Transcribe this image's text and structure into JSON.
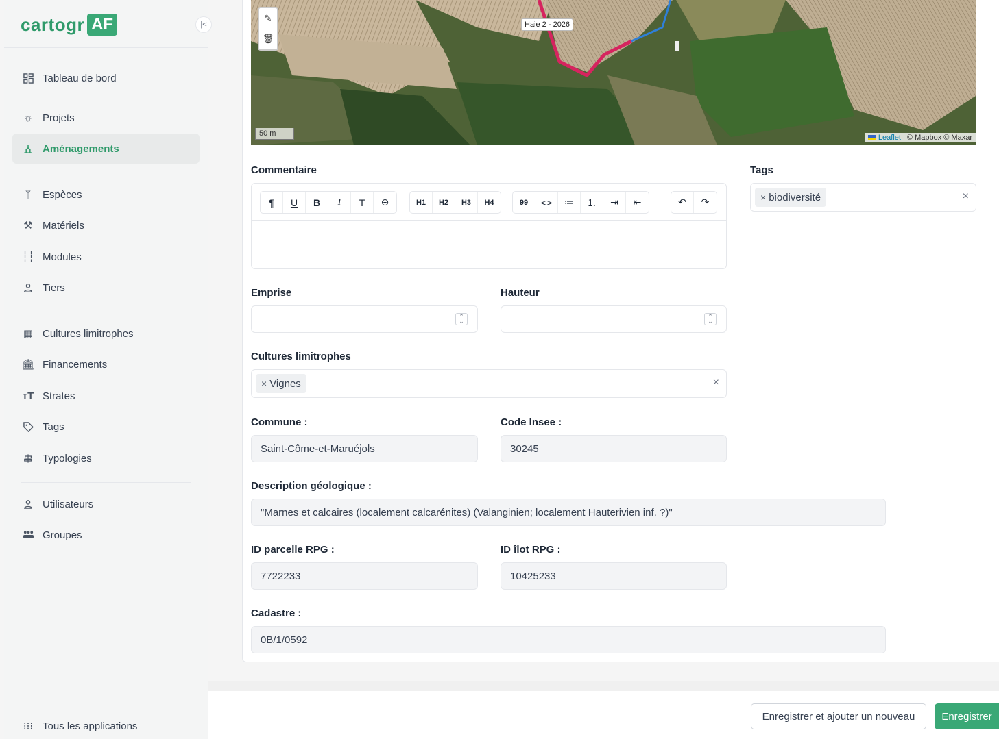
{
  "app": {
    "logo_text": "cartogr",
    "logo_badge": "AF"
  },
  "sidebar": {
    "collapse_icon": "chevrons-left-icon",
    "items": [
      {
        "label": "Tableau de bord",
        "icon": "dashboard-icon"
      },
      {
        "label": "Projets",
        "icon": "sun-icon"
      },
      {
        "label": "Aménagements",
        "icon": "planting-icon",
        "active": true
      },
      {
        "label": "Espèces",
        "icon": "sprout-icon"
      },
      {
        "label": "Matériels",
        "icon": "tools-icon"
      },
      {
        "label": "Modules",
        "icon": "modules-icon"
      },
      {
        "label": "Tiers",
        "icon": "user-icon"
      },
      {
        "label": "Cultures limitrophes",
        "icon": "field-icon"
      },
      {
        "label": "Financements",
        "icon": "bank-icon"
      },
      {
        "label": "Strates",
        "icon": "text-size-icon"
      },
      {
        "label": "Tags",
        "icon": "tag-icon"
      },
      {
        "label": "Typologies",
        "icon": "signpost-icon"
      },
      {
        "label": "Utilisateurs",
        "icon": "user-icon"
      },
      {
        "label": "Groupes",
        "icon": "group-icon"
      }
    ],
    "bottom": {
      "label": "Tous les applications",
      "icon": "grid-dots-icon"
    }
  },
  "map": {
    "feature_label": "Haie 2 - 2026",
    "scale": "50 m",
    "attribution_link": "Leaflet",
    "attribution_rest": " | © Mapbox © Maxar"
  },
  "form": {
    "commentaire": {
      "label": "Commentaire",
      "value": ""
    },
    "tags": {
      "label": "Tags",
      "chips": [
        "biodiversité"
      ]
    },
    "emprise": {
      "label": "Emprise",
      "value": ""
    },
    "hauteur": {
      "label": "Hauteur",
      "value": ""
    },
    "cultures": {
      "label": "Cultures limitrophes",
      "chips": [
        "Vignes"
      ]
    },
    "commune": {
      "label": "Commune :",
      "value": "Saint-Côme-et-Maruéjols"
    },
    "code_insee": {
      "label": "Code Insee :",
      "value": "30245"
    },
    "description_geo": {
      "label": "Description géologique :",
      "value": "\"Marnes et calcaires (localement calcarénites) (Valanginien; localement Hauterivien inf. ?)\""
    },
    "id_parcelle": {
      "label": "ID parcelle RPG :",
      "value": "7722233"
    },
    "id_ilot": {
      "label": "ID îlot RPG :",
      "value": "10425233"
    },
    "cadastre": {
      "label": "Cadastre :",
      "value": "0B/1/0592"
    }
  },
  "toolbar": {
    "group1": [
      "¶",
      "U",
      "B",
      "I",
      "T",
      "⊝"
    ],
    "group2": [
      "H1",
      "H2",
      "H3",
      "H4"
    ],
    "group3": [
      "99",
      "<>",
      "≔",
      "⒈",
      "⇥",
      "⇤"
    ],
    "group4": [
      "↶",
      "↷"
    ]
  },
  "footer": {
    "save_and_new": "Enregistrer et ajouter un nouveau",
    "save": "Enregistrer"
  },
  "colors": {
    "accent": "#3aa876",
    "hedge_outline": "#d6245f",
    "hedge_blue": "#2f7fd8"
  }
}
